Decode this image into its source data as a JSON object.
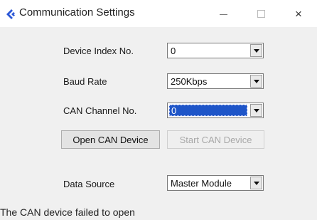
{
  "window": {
    "title": "Communication Settings",
    "minimize_label": "—",
    "close_label": "×"
  },
  "form": {
    "device_index": {
      "label": "Device Index No.",
      "value": "0"
    },
    "baud_rate": {
      "label": "Baud Rate",
      "value": "250Kbps"
    },
    "can_channel": {
      "label": "CAN Channel No.",
      "value": "0"
    },
    "data_source": {
      "label": "Data Source",
      "value": "Master Module"
    }
  },
  "buttons": {
    "open_can": "Open CAN Device",
    "start_can": "Start CAN Device"
  },
  "status_text": "The CAN device failed to open",
  "colors": {
    "selection": "#1e55c8",
    "app_icon": "#2b57d6",
    "disabled_text": "#a8a8a8"
  }
}
